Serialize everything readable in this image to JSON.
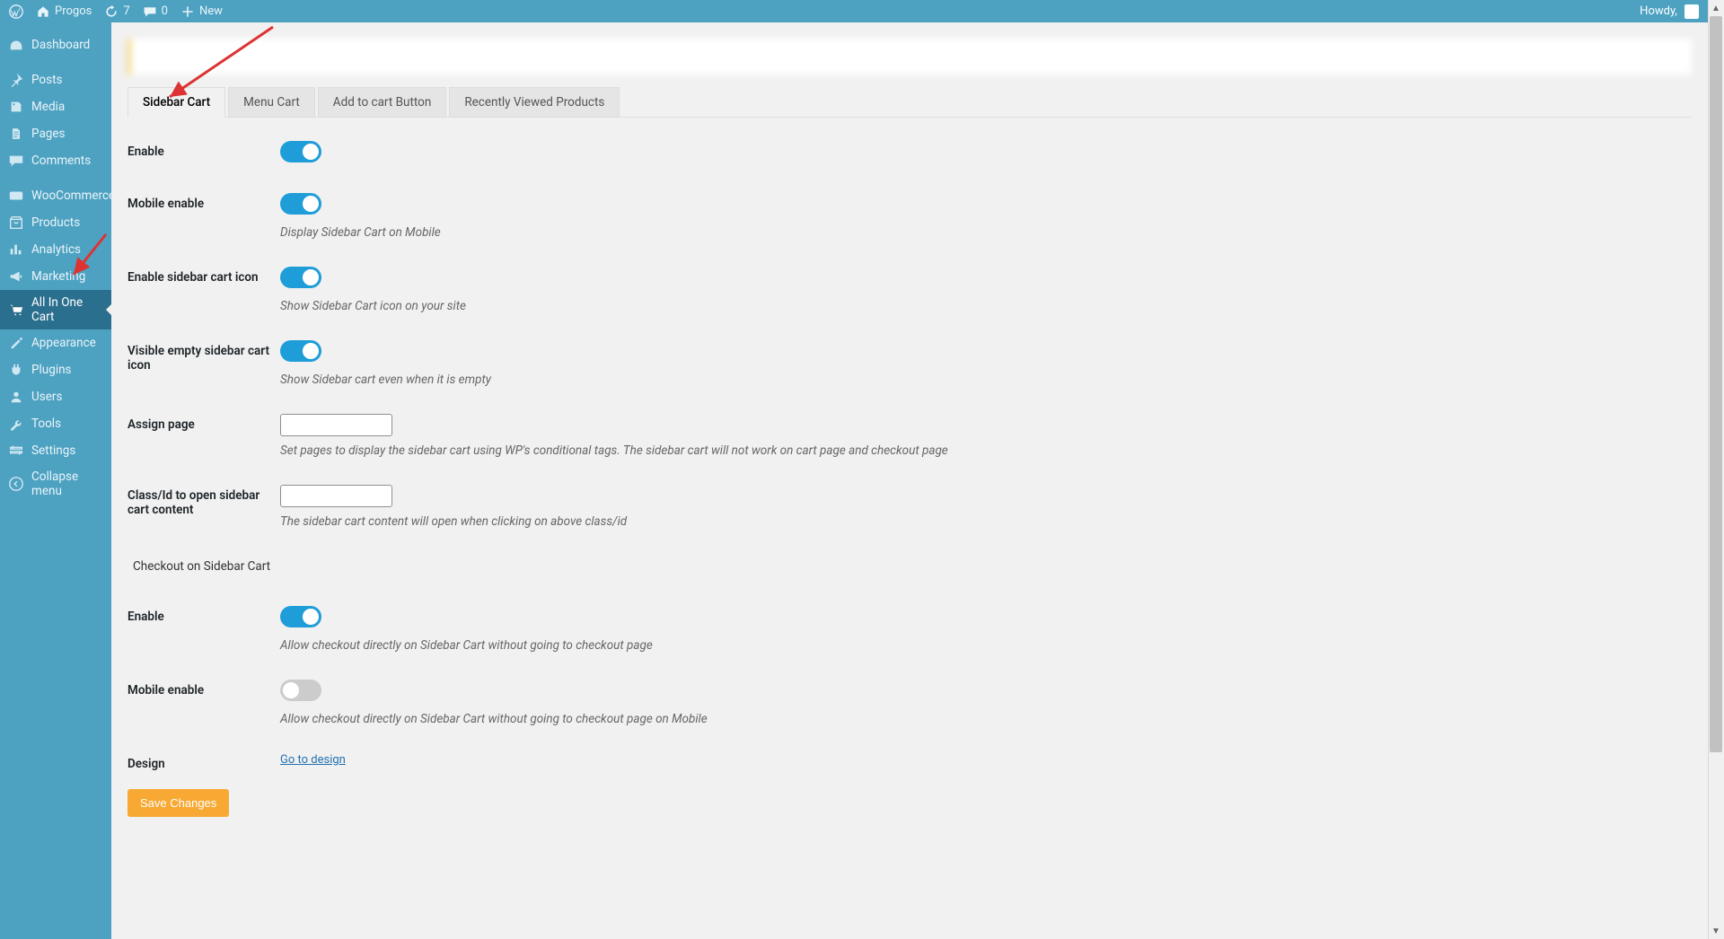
{
  "adminbar": {
    "site_name": "Progos",
    "updates": "7",
    "comments": "0",
    "new_label": "New",
    "howdy": "Howdy,"
  },
  "sidebar": {
    "items": [
      {
        "label": "Dashboard",
        "icon": "dashboard"
      },
      {
        "label": "Posts",
        "icon": "pushpin"
      },
      {
        "label": "Media",
        "icon": "media"
      },
      {
        "label": "Pages",
        "icon": "pages"
      },
      {
        "label": "Comments",
        "icon": "comments"
      },
      {
        "label": "WooCommerce",
        "icon": "woo"
      },
      {
        "label": "Products",
        "icon": "products"
      },
      {
        "label": "Analytics",
        "icon": "analytics"
      },
      {
        "label": "Marketing",
        "icon": "megaphone"
      },
      {
        "label": "All In One Cart",
        "icon": "cart"
      },
      {
        "label": "Appearance",
        "icon": "appearance"
      },
      {
        "label": "Plugins",
        "icon": "plugins"
      },
      {
        "label": "Users",
        "icon": "users"
      },
      {
        "label": "Tools",
        "icon": "tools"
      },
      {
        "label": "Settings",
        "icon": "settings"
      },
      {
        "label": "Collapse menu",
        "icon": "collapse"
      }
    ]
  },
  "tabs": [
    {
      "label": "Sidebar Cart",
      "active": true
    },
    {
      "label": "Menu Cart",
      "active": false
    },
    {
      "label": "Add to cart Button",
      "active": false
    },
    {
      "label": "Recently Viewed Products",
      "active": false
    }
  ],
  "form": {
    "enable": {
      "label": "Enable",
      "on": true
    },
    "mobile_enable": {
      "label": "Mobile enable",
      "on": true,
      "desc": "Display Sidebar Cart on Mobile"
    },
    "enable_icon": {
      "label": "Enable sidebar cart icon",
      "on": true,
      "desc": "Show Sidebar Cart icon on your site"
    },
    "visible_empty": {
      "label": "Visible empty sidebar cart icon",
      "on": true,
      "desc": "Show Sidebar cart even when it is empty"
    },
    "assign_page": {
      "label": "Assign page",
      "value": "",
      "desc": "Set pages to display the sidebar cart using WP's conditional tags. The sidebar cart will not work on cart page and checkout page"
    },
    "class_id": {
      "label": "Class/Id to open sidebar cart content",
      "value": "",
      "desc": "The sidebar cart content will open when clicking on above class/id"
    },
    "section_checkout": "Checkout on Sidebar Cart",
    "checkout_enable": {
      "label": "Enable",
      "on": true,
      "desc": "Allow checkout directly on Sidebar Cart without going to checkout page"
    },
    "checkout_mobile": {
      "label": "Mobile enable",
      "on": false,
      "desc": "Allow checkout directly on Sidebar Cart without going to checkout page on Mobile"
    },
    "design": {
      "label": "Design",
      "link": "Go to design"
    },
    "save": "Save Changes"
  }
}
